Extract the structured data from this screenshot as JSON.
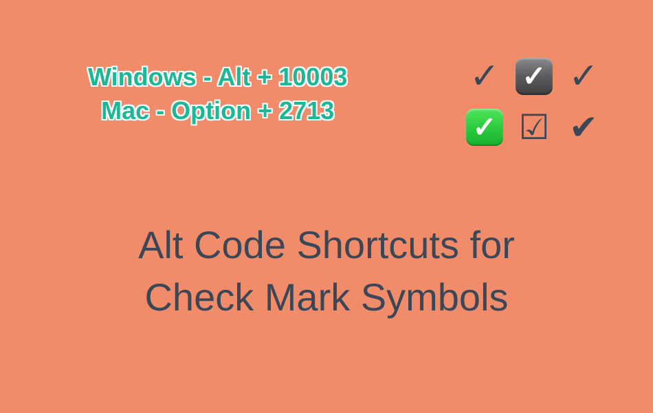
{
  "shortcuts": {
    "windows": "Windows - Alt + 10003",
    "mac": "Mac - Option + 2713"
  },
  "icons": {
    "row1": {
      "a": "✓",
      "b": "✓",
      "c": "✓"
    },
    "row2": {
      "a": "✓",
      "b": "☑",
      "c": "✔"
    }
  },
  "title": {
    "line1": "Alt Code Shortcuts for",
    "line2": "Check Mark Symbols"
  },
  "colors": {
    "background": "#f08c6a",
    "text_dark": "#3b4657",
    "text_teal": "#1bb896",
    "outline_white": "#ffffff",
    "box_green": "#2ecc3f",
    "box_dark": "#5c5c5f"
  }
}
